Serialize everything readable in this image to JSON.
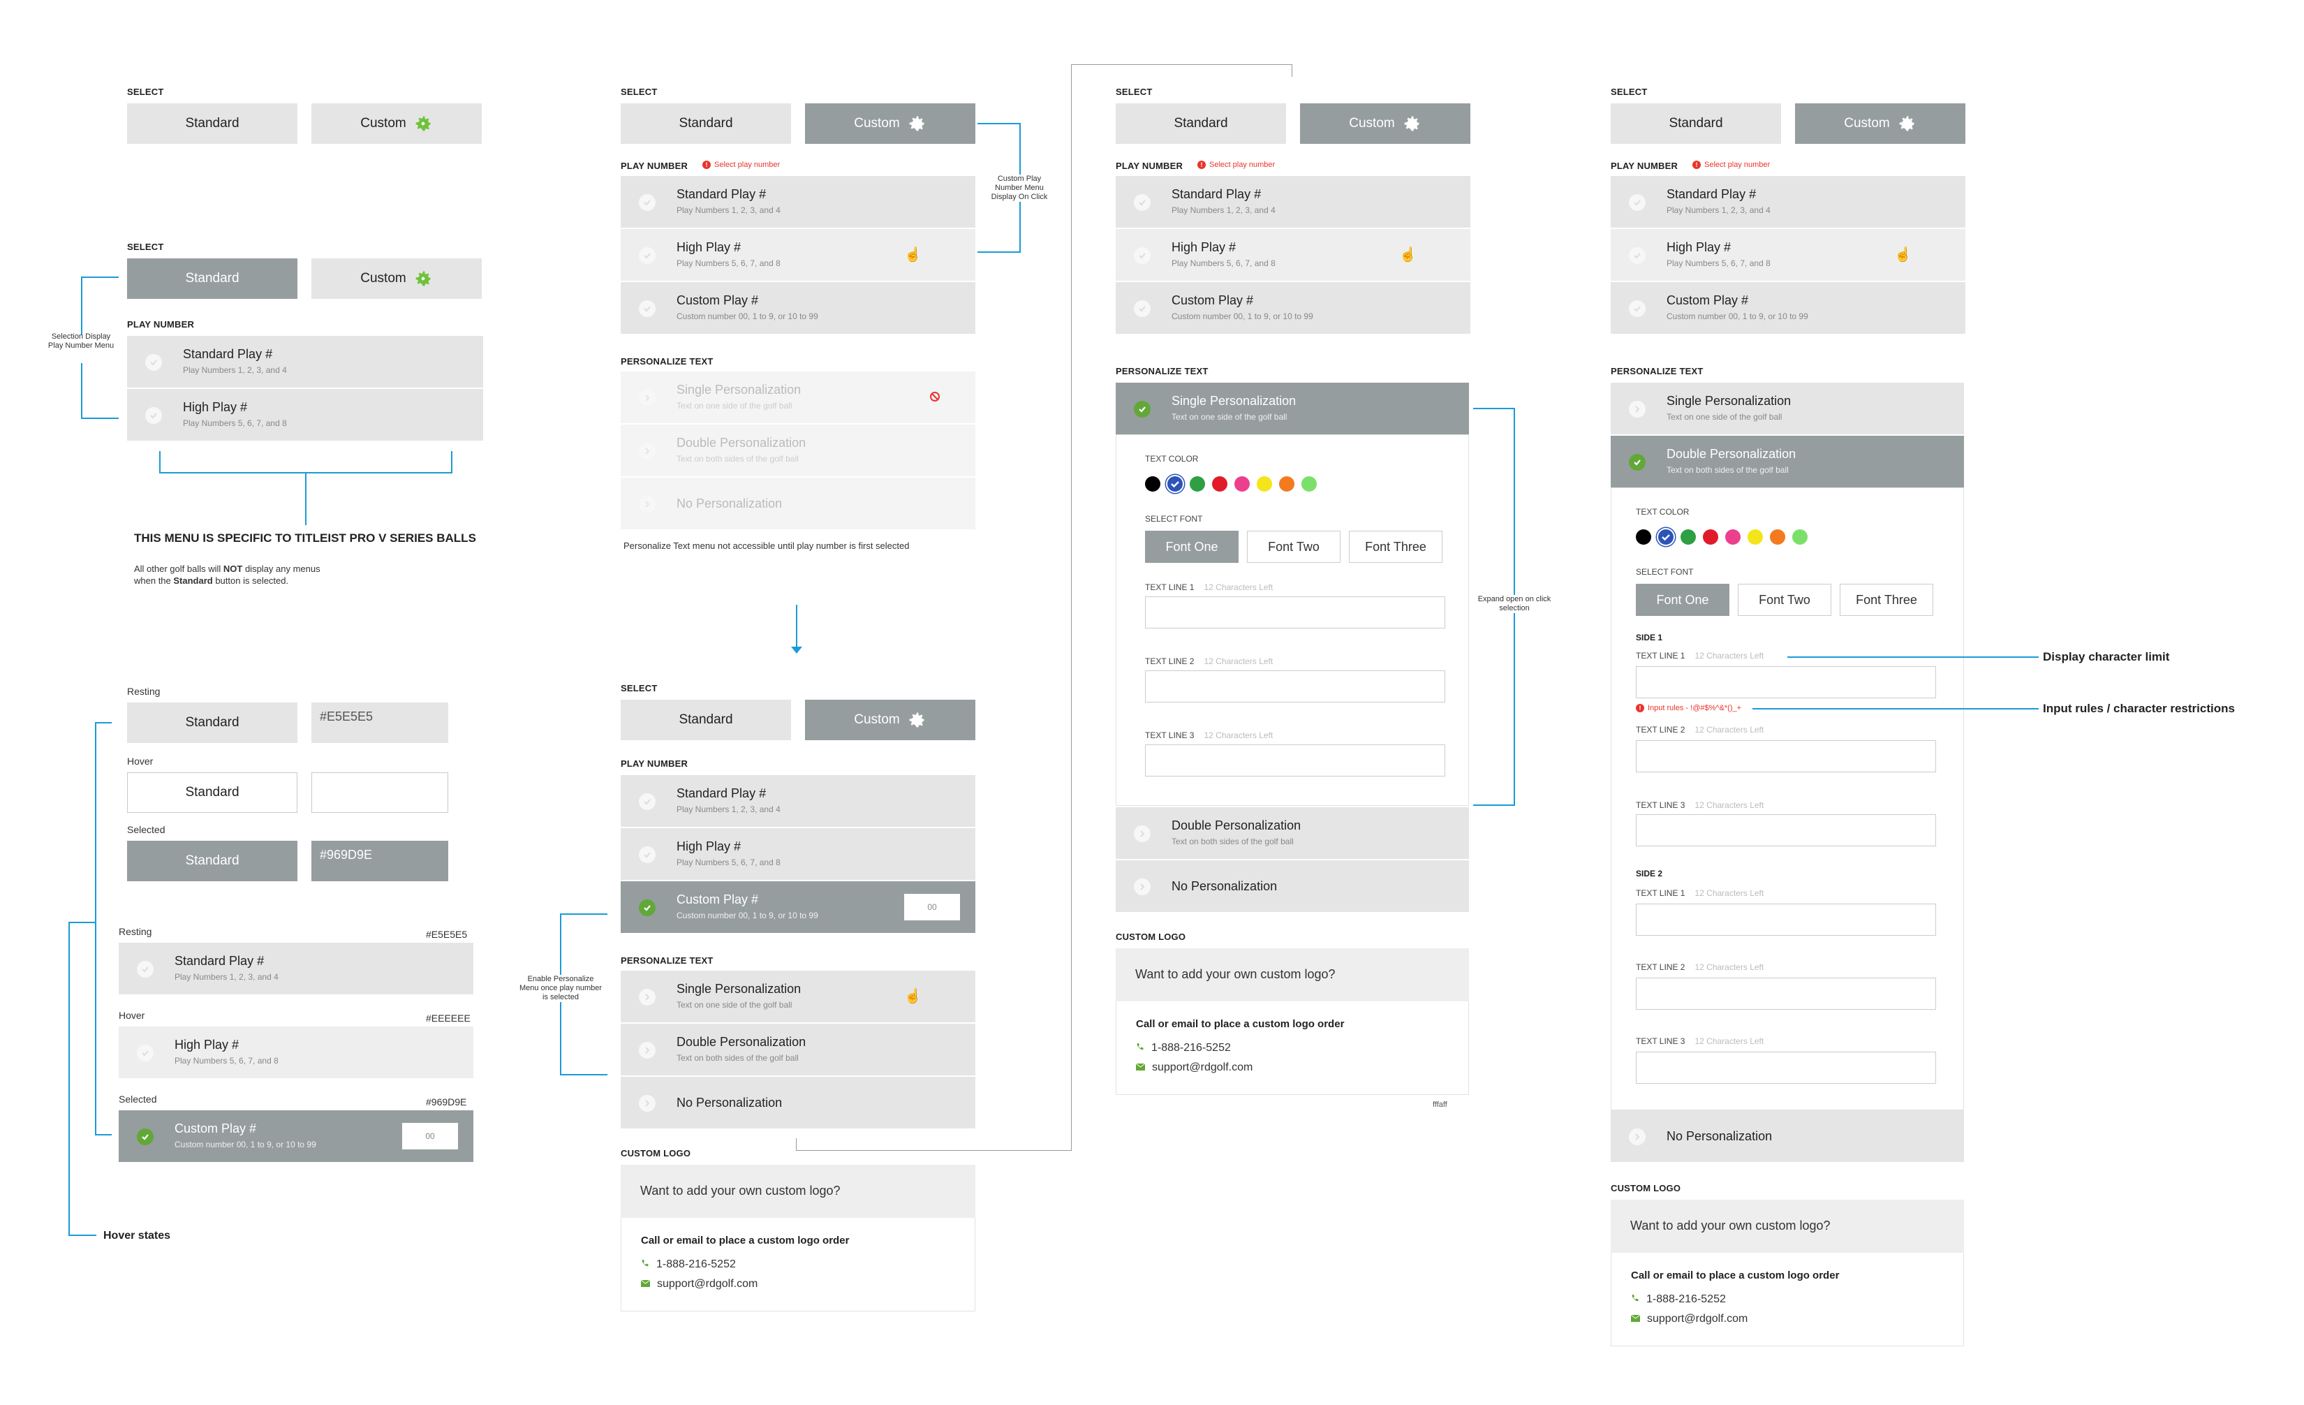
{
  "colors": {
    "resting": "#E5E5E5",
    "hover": "#EEEEEE",
    "selected": "#969D9E",
    "accent": "#1a9bd7",
    "check": "#62a838",
    "error": "#e8342b"
  },
  "labels": {
    "select": "SELECT",
    "play_number": "PLAY NUMBER",
    "personalize_text": "PERSONALIZE TEXT",
    "custom_logo": "CUSTOM LOGO",
    "text_color": "TEXT COLOR",
    "select_font": "SELECT FONT",
    "side1": "SIDE 1",
    "side2": "SIDE 2"
  },
  "buttons": {
    "standard": "Standard",
    "custom": "Custom"
  },
  "error_select_play": "Select play number",
  "play": {
    "standard": {
      "title": "Standard Play #",
      "sub": "Play Numbers 1, 2, 3, and 4"
    },
    "high": {
      "title": "High Play #",
      "sub": "Play Numbers 5, 6, 7, and 8"
    },
    "custom": {
      "title": "Custom Play #",
      "sub": "Custom number 00, 1 to 9, or 10 to 99"
    },
    "custom_value": "00"
  },
  "pers": {
    "single": {
      "title": "Single Personalization",
      "sub": "Text on one side of the golf ball"
    },
    "double": {
      "title": "Double Personalization",
      "sub": "Text on both sides of the golf ball"
    },
    "none": "No Personalization"
  },
  "fonts": [
    "Font One",
    "Font Two",
    "Font Three"
  ],
  "text_lines": {
    "l1": "TEXT LINE 1",
    "l2": "TEXT LINE 2",
    "l3": "TEXT LINE 3",
    "chars_left": "12 Characters Left"
  },
  "input_rules_error": "Input rules - !@#$%^&*()_+",
  "logo": {
    "question": "Want to add your own custom logo?",
    "heading": "Call or email to place a custom logo order",
    "phone": "1-888-216-5252",
    "email": "support@rdgolf.com"
  },
  "swatches": [
    "#000000",
    "#2c53b8",
    "#2ea043",
    "#e21b2a",
    "#ec3f8e",
    "#f4e41a",
    "#f47a20",
    "#7be06a"
  ],
  "annotations": {
    "selection_display": "Selection Display Play Number Menu",
    "menu_specific": "THIS MENU IS SPECIFIC TO TITLEIST PRO V SERIES BALLS",
    "other_balls_1": "All other golf balls will ",
    "other_balls_not": "NOT",
    "other_balls_2": " display any menus",
    "other_balls_3": "when the ",
    "other_balls_std": "Standard",
    "other_balls_4": " button is selected.",
    "custom_play_display": "Custom Play Number Menu Display On Click",
    "pers_not_accessible": "Personalize Text menu not accessible until play number is first selected",
    "enable_pers": "Enable Personalize Menu once play number is selected",
    "expand_open": "Expand open on click selection",
    "display_char_limit": "Display character limit",
    "input_rules": "Input rules / character restrictions",
    "hover_states": "Hover states",
    "fffaff": "fffaff"
  },
  "states": {
    "resting": "Resting",
    "hover": "Hover",
    "selected": "Selected",
    "hex_resting": "#E5E5E5",
    "hex_hover": "#EEEEEE",
    "hex_selected": "#969D9E"
  }
}
